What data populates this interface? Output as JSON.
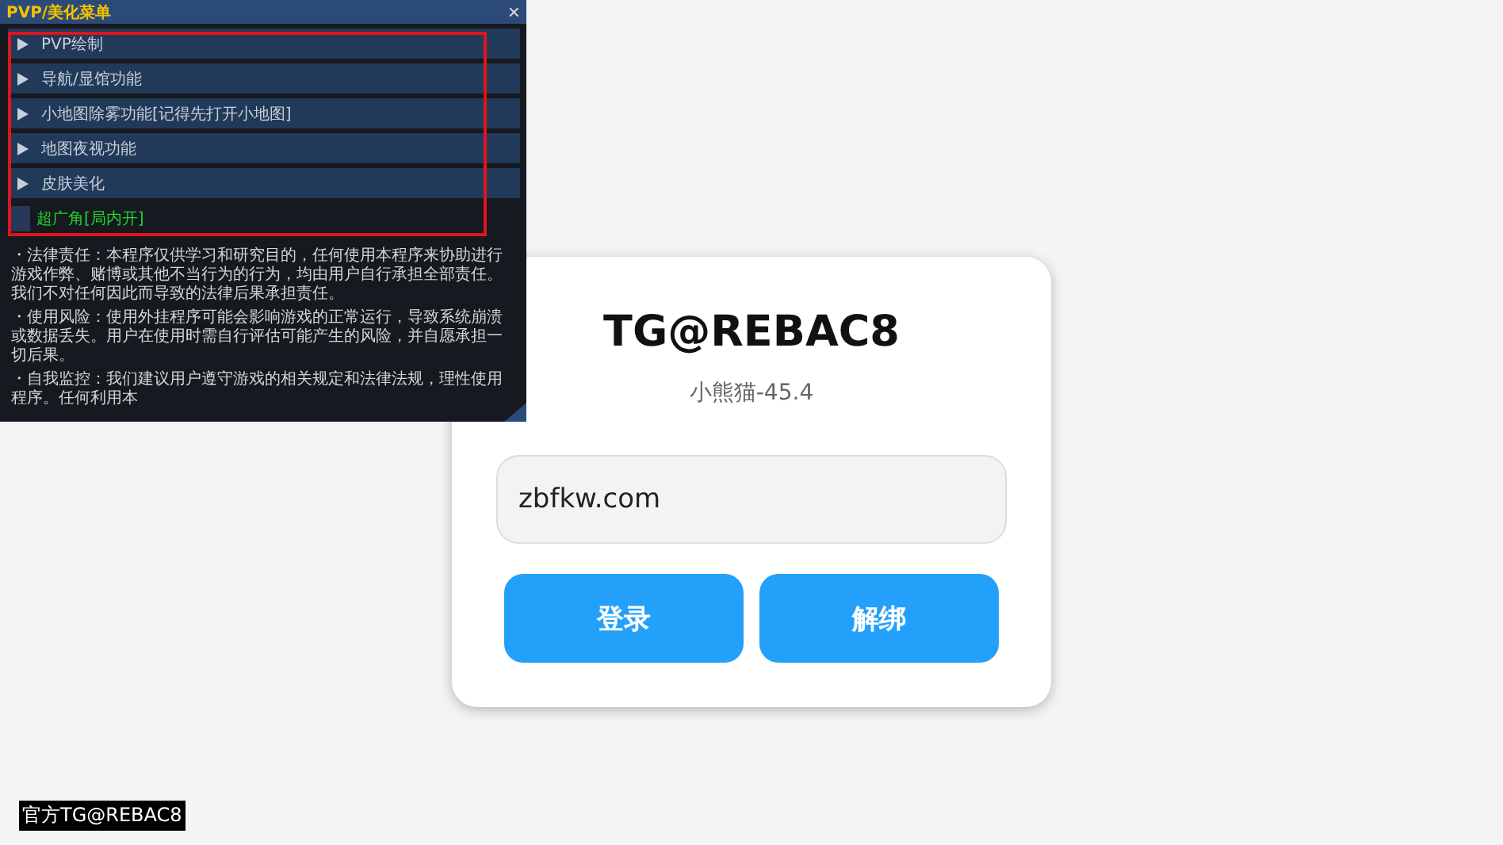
{
  "menu": {
    "title": "PVP/美化菜单",
    "close": "×",
    "sections": [
      {
        "label": "PVP绘制",
        "expanded": false
      },
      {
        "label": "导航/显馆功能",
        "expanded": false
      },
      {
        "label": "小地图除雾功能[记得先打开小地图]",
        "expanded": false
      },
      {
        "label": "地图夜视功能",
        "expanded": false
      },
      {
        "label": "皮肤美化",
        "expanded": false
      }
    ],
    "option": {
      "label": "超广角[局内开]",
      "checked": false
    },
    "notices": [
      "・法律责任：本程序仅供学习和研究目的，任何使用本程序来协助进行游戏作弊、赌博或其他不当行为的行为，均由用户自行承担全部责任。我们不对任何因此而导致的法律后果承担责任。",
      "・使用风险：使用外挂程序可能会影响游戏的正常运行，导致系统崩溃或数据丢失。用户在使用时需自行评估可能产生的风险，并自愿承担一切后果。",
      "・自我监控：我们建议用户遵守游戏的相关规定和法律法规，理性使用程序。任何利用本"
    ]
  },
  "login": {
    "title": "TG@REBAC8",
    "subtitle": "小熊猫-45.4",
    "input": {
      "value": "zbfkw.com"
    },
    "buttons": [
      "登录",
      "解绑"
    ]
  },
  "footer": "官方TG@REBAC8"
}
